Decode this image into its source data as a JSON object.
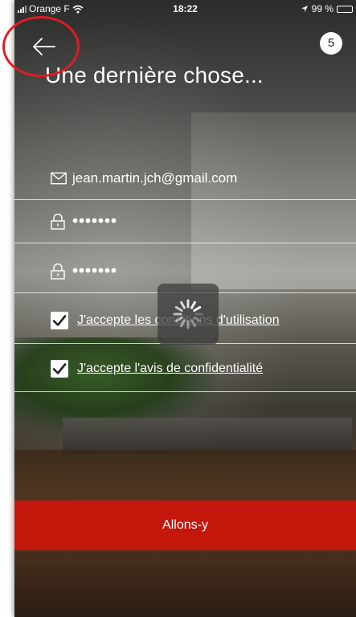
{
  "status_bar": {
    "carrier": "Orange F",
    "time": "18:22",
    "battery": "99 %",
    "battery_fill": 0.99
  },
  "header": {
    "step": "5",
    "title": "Une dernière chose..."
  },
  "form": {
    "email": "jean.martin.jch@gmail.com",
    "password": "•••••••",
    "password_confirm": "•••••••",
    "terms_label": "J'accepte les conditions d'utilisation",
    "privacy_label": "J'accepte l'avis de confidentialité",
    "terms_checked": true,
    "privacy_checked": true
  },
  "actions": {
    "submit_label": "Allons-y"
  },
  "colors": {
    "accent": "#c4170c",
    "annotation": "#e01b24",
    "battery": "#f2d100"
  },
  "icons": [
    "back-arrow-icon",
    "mail-icon",
    "lock-icon",
    "check-icon",
    "spinner-icon",
    "wifi-icon",
    "location-arrow-icon"
  ]
}
